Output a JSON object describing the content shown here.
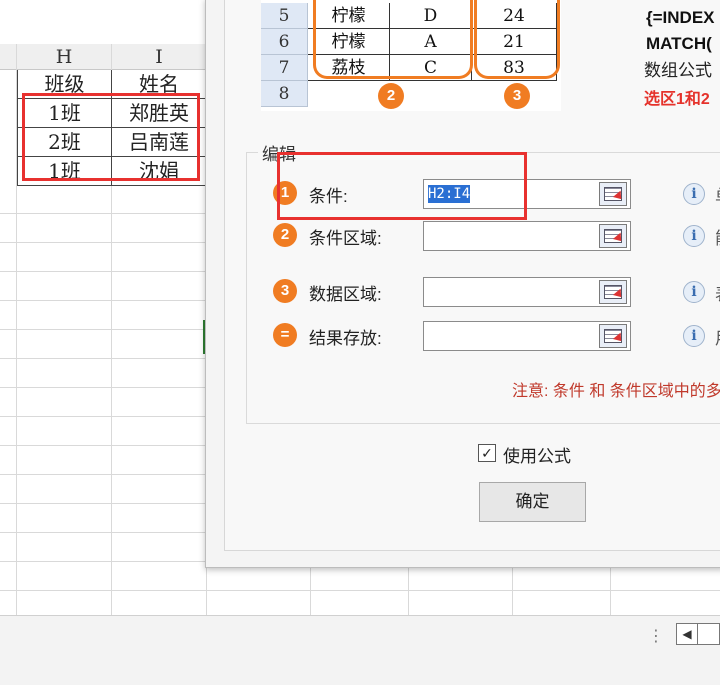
{
  "spreadsheet": {
    "columns": [
      "H",
      "I"
    ],
    "rows": [
      [
        "班级",
        "姓名"
      ],
      [
        "1班",
        "郑胜英"
      ],
      [
        "2班",
        "吕南莲"
      ],
      [
        "1班",
        "沈娟"
      ]
    ]
  },
  "example": {
    "rows": [
      {
        "num": "5",
        "fruit": "柠檬",
        "code": "D",
        "value": "24"
      },
      {
        "num": "6",
        "fruit": "柠檬",
        "code": "A",
        "value": "21"
      },
      {
        "num": "7",
        "fruit": "荔枝",
        "code": "C",
        "value": "83"
      },
      {
        "num": "8",
        "fruit": "",
        "code": "",
        "value": ""
      }
    ],
    "badge2": "2",
    "badge3": "3",
    "formula_line1": "{=INDEX",
    "formula_line2": "MATCH(",
    "note_line1": "数组公式",
    "note_line2": "选区1和2"
  },
  "dialog": {
    "group_title": "编辑",
    "fields": [
      {
        "badge": "1",
        "label": "条件:",
        "value": "H2:I4",
        "hint": "单"
      },
      {
        "badge": "2",
        "label": "条件区域:",
        "value": "",
        "hint": "能"
      },
      {
        "badge": "3",
        "label": "数据区域:",
        "value": "",
        "hint": "表"
      },
      {
        "badge": "=",
        "label": "结果存放:",
        "value": "",
        "hint": "用"
      }
    ],
    "note": "注意: 条件 和 条件区域中的多个字段 必须一一对应",
    "use_formula_label": "使用公式",
    "use_formula_checked": "✓",
    "ok_label": "确定"
  },
  "statusbar": {
    "dots": "⋮",
    "left_arrow": "◀"
  },
  "colors": {
    "red_highlight": "#e8312f",
    "orange_badge": "#f07c22",
    "selection_blue": "#2a6fd3"
  }
}
